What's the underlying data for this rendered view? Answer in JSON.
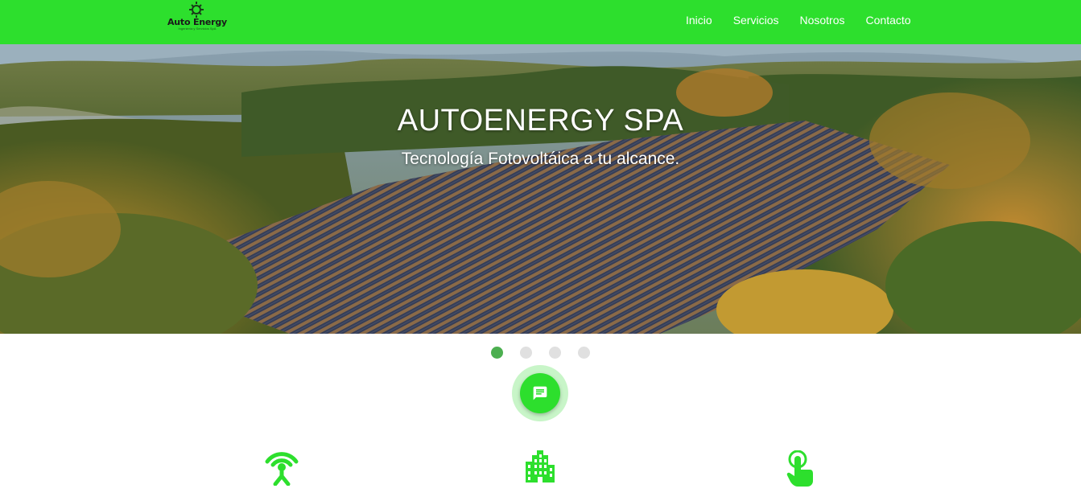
{
  "brand": {
    "name": "Auto Energy",
    "tagline": "Ingeniería y Servicios SpA",
    "color": "#2ddf2d"
  },
  "nav": {
    "items": [
      {
        "label": "Inicio"
      },
      {
        "label": "Servicios"
      },
      {
        "label": "Nosotros"
      },
      {
        "label": "Contacto"
      }
    ]
  },
  "hero": {
    "title": "AUTOENERGY SPA",
    "subtitle": "Tecnología Fotovoltáica a tu alcance."
  },
  "carousel": {
    "slide_count": 4,
    "active_index": 0
  },
  "chat": {
    "icon": "chat-icon"
  },
  "features": [
    {
      "icon": "antenna-icon"
    },
    {
      "icon": "building-icon"
    },
    {
      "icon": "touch-icon"
    }
  ]
}
